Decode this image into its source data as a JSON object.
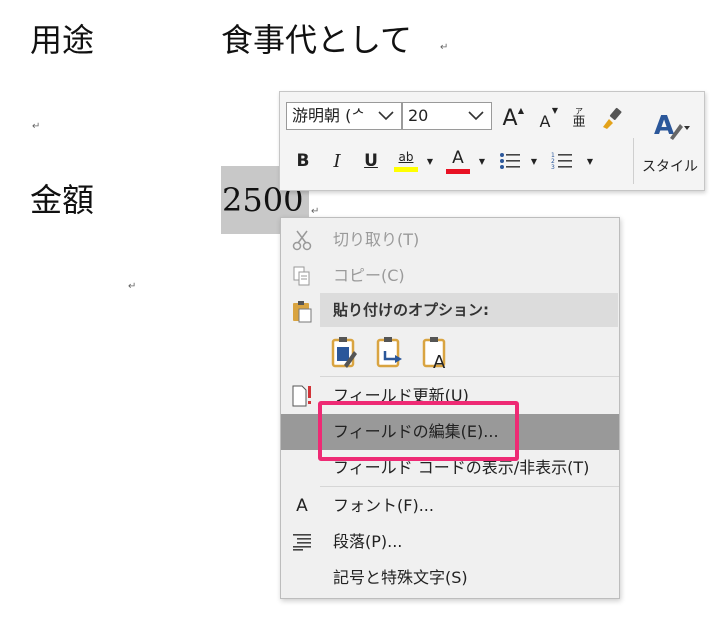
{
  "document": {
    "line1_label": "用途",
    "line1_value": "食事代として",
    "line2_label": "金額",
    "line2_value": "2500",
    "paragraph_mark": "↵"
  },
  "toolbar": {
    "font_name": "游明朝 (ᄼ",
    "font_size": "20",
    "grow_font": "A",
    "shrink_font": "A",
    "phonetic_top": "ア",
    "phonetic_bottom": "亜",
    "bold": "B",
    "italic": "I",
    "underline": "U",
    "highlight": "ab",
    "font_color": "A",
    "styles_label": "スタイル",
    "highlight_color": "#ffff00",
    "font_color_bar": "#e81123",
    "style_icon_color": "#2b579a"
  },
  "context_menu": {
    "cut": "切り取り(T)",
    "copy": "コピー(C)",
    "paste_options_header": "貼り付けのオプション:",
    "update_field": "フィールド更新(U)",
    "edit_field": "フィールドの編集(E)...",
    "toggle_field_codes": "フィールド コードの表示/非表示(T)",
    "font": "フォント(F)...",
    "paragraph": "段落(P)...",
    "symbols": "記号と特殊文字(S)"
  },
  "annotation_color": "#ee2a74"
}
